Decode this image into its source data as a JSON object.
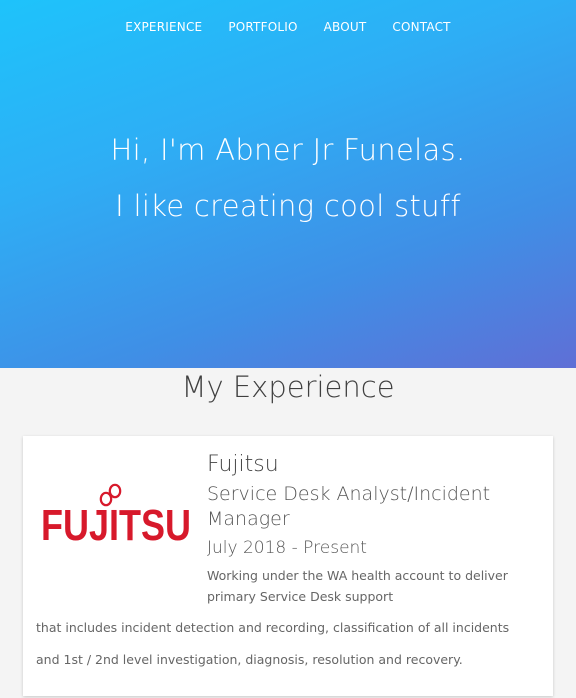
{
  "nav": {
    "items": [
      {
        "label": "EXPERIENCE"
      },
      {
        "label": "PORTFOLIO"
      },
      {
        "label": "ABOUT"
      },
      {
        "label": "CONTACT"
      }
    ]
  },
  "hero": {
    "title": "Hi, I'm Abner Jr Funelas.",
    "subtitle": "I like creating cool stuff",
    "gradient_start": "#1ec3fb",
    "gradient_end": "#5f6fd6"
  },
  "experience": {
    "section_title": "My Experience",
    "items": [
      {
        "logo_text": "FUJITSU",
        "logo_color": "#d7192b",
        "company": "Fujitsu",
        "role": "Service Desk Analyst/Incident Manager",
        "dates": "July 2018 - Present",
        "description_top": "Working under the WA health account to deliver primary Service Desk support",
        "description_line_1": "that includes incident detection and recording, classification of all incidents",
        "description_line_2": "and 1st / 2nd level investigation, diagnosis, resolution and recovery."
      }
    ]
  }
}
